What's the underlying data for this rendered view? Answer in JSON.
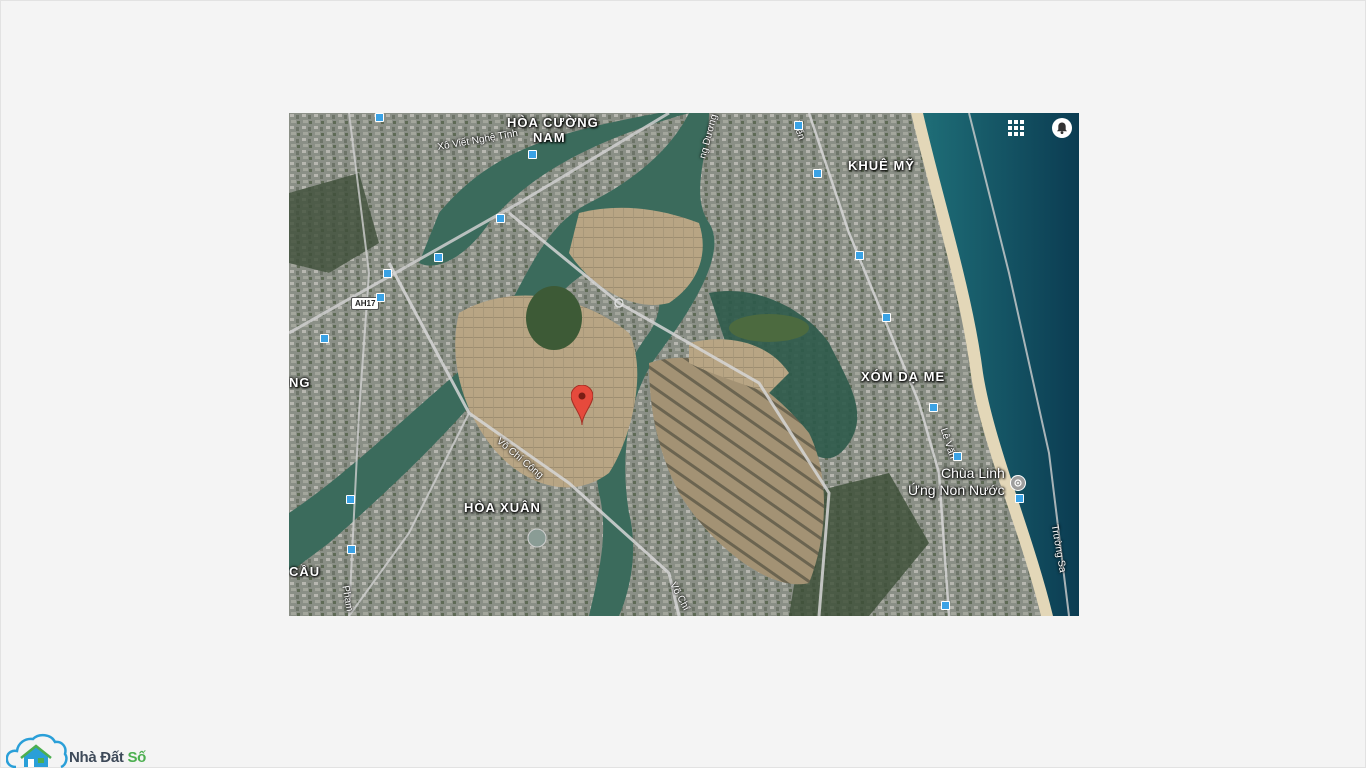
{
  "map": {
    "labels": {
      "hoa_cuong_nam_1": "HÒA CƯỜNG",
      "hoa_cuong_nam_2": "NAM",
      "khue_my": "KHUÊ MỸ",
      "xom_da_me": "XÓM DẠ ME",
      "hoa_xuan": "HÒA XUÂN",
      "left_edge_ng": "NG",
      "left_edge_cau": "CẦU"
    },
    "roads": {
      "xo_viet_nghe_tinh": "Xô Viết Nghệ Tĩnh",
      "vo_chi_cong_1": "Võ Chí Công",
      "vo_chi_cong_2": "Võ Chí",
      "pham": "Phạm",
      "le_van": "Lê Văn",
      "truong_sa": "Trường Sa",
      "ng_duong": "ng Dương",
      "tien": "Tiến"
    },
    "highway_shield": "AH17",
    "poi": {
      "name_line1": "Chùa Linh",
      "name_line2": "Ứng Non Nước",
      "icon": "temple-icon"
    },
    "controls": {
      "apps_icon": "apps-grid-icon",
      "notifications_icon": "notifications-bell-icon"
    },
    "marker_icon": "map-pin-icon"
  },
  "brand": {
    "logo_icon": "cloud-house-icon",
    "name_part1": "Nhà Đất",
    "name_part2": "Số",
    "colors": {
      "dark": "#3e4a59",
      "green": "#4caf50",
      "blue": "#2a9fd8"
    }
  }
}
